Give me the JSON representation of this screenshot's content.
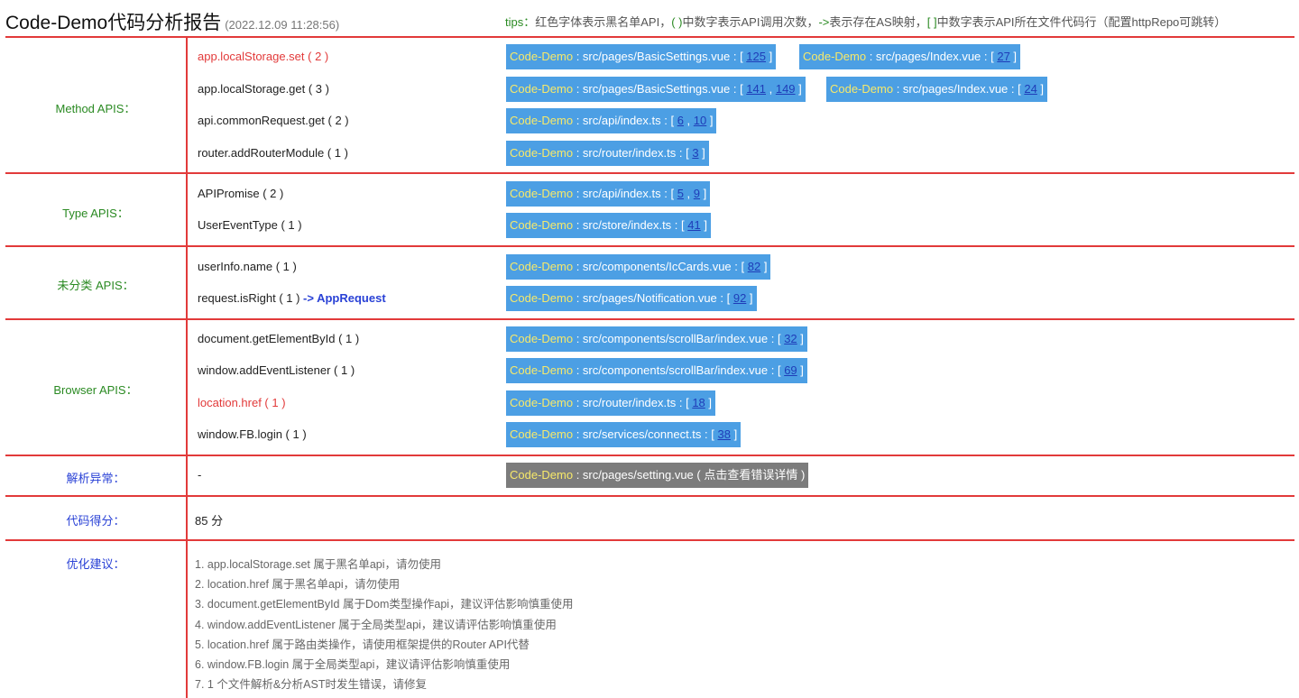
{
  "header": {
    "title": "Code-Demo代码分析报告",
    "time": "(2022.12.09 11:28:56)",
    "tips_prefix": "tips：",
    "tips_text": "红色字体表示黑名单API，",
    "tips_paren": "( )",
    "tips_mid1": "中数字表示API调用次数，",
    "tips_arrow": "->",
    "tips_mid2": "表示存在AS映射，",
    "tips_bracket": "[ ]",
    "tips_end": "中数字表示API所在文件代码行（配置httpRepo可跳转）"
  },
  "sections": {
    "method": {
      "label": "Method APIS：",
      "rows": [
        {
          "api": "app.localStorage.set ( 2 )",
          "chips": [
            {
              "project": "Code-Demo",
              "path": " : src/pages/BasicSettings.vue : [ ",
              "lines": [
                "125"
              ],
              "end": " ]"
            },
            {
              "project": "Code-Demo",
              "path": " : src/pages/Index.vue : [ ",
              "lines": [
                "27"
              ],
              "end": " ]"
            }
          ]
        },
        {
          "api": "app.localStorage.get ( 3 )",
          "chips": [
            {
              "project": "Code-Demo",
              "path": " : src/pages/BasicSettings.vue : [ ",
              "lines": [
                "141",
                "149"
              ],
              "end": " ]"
            },
            {
              "project": "Code-Demo",
              "path": " : src/pages/Index.vue : [ ",
              "lines": [
                "24"
              ],
              "end": " ]"
            }
          ]
        },
        {
          "api": "api.commonRequest.get ( 2 )",
          "chips": [
            {
              "project": "Code-Demo",
              "path": " : src/api/index.ts : [ ",
              "lines": [
                "6",
                "10"
              ],
              "end": " ]"
            }
          ]
        },
        {
          "api": "router.addRouterModule ( 1 )",
          "chips": [
            {
              "project": "Code-Demo",
              "path": " : src/router/index.ts : [ ",
              "lines": [
                "3"
              ],
              "end": " ]"
            }
          ]
        }
      ]
    },
    "type": {
      "label": "Type APIS：",
      "rows": [
        {
          "api": "APIPromise ( 2 )",
          "chips": [
            {
              "project": "Code-Demo",
              "path": " : src/api/index.ts : [ ",
              "lines": [
                "5",
                "9"
              ],
              "end": " ]"
            }
          ]
        },
        {
          "api": "UserEventType ( 1 )",
          "chips": [
            {
              "project": "Code-Demo",
              "path": " : src/store/index.ts : [ ",
              "lines": [
                "41"
              ],
              "end": " ]"
            }
          ]
        }
      ]
    },
    "uncat": {
      "label": "未分类 APIS：",
      "rows": [
        {
          "api": "userInfo.name ( 1 )",
          "chips": [
            {
              "project": "Code-Demo",
              "path": " : src/components/IcCards.vue : [ ",
              "lines": [
                "82"
              ],
              "end": " ]"
            }
          ]
        },
        {
          "api": "request.isRight ( 1 ) ",
          "arrow": "-> AppRequest",
          "chips": [
            {
              "project": "Code-Demo",
              "path": " : src/pages/Notification.vue : [ ",
              "lines": [
                "92"
              ],
              "end": " ]"
            }
          ]
        }
      ]
    },
    "browser": {
      "label": "Browser APIS：",
      "rows": [
        {
          "api": "document.getElementById ( 1 )",
          "chips": [
            {
              "project": "Code-Demo",
              "path": " : src/components/scrollBar/index.vue : [ ",
              "lines": [
                "32"
              ],
              "end": " ]"
            }
          ]
        },
        {
          "api": "window.addEventListener ( 1 )",
          "chips": [
            {
              "project": "Code-Demo",
              "path": " : src/components/scrollBar/index.vue : [ ",
              "lines": [
                "69"
              ],
              "end": " ]"
            }
          ]
        },
        {
          "api": "location.href ( 1 )",
          "chips": [
            {
              "project": "Code-Demo",
              "path": " : src/router/index.ts : [ ",
              "lines": [
                "18"
              ],
              "end": " ]"
            }
          ]
        },
        {
          "api": "window.FB.login ( 1 )",
          "chips": [
            {
              "project": "Code-Demo",
              "path": " : src/services/connect.ts : [ ",
              "lines": [
                "38"
              ],
              "end": " ]"
            }
          ]
        }
      ]
    },
    "parse_error": {
      "label": "解析异常：",
      "value": "-",
      "chip_project": "Code-Demo",
      "chip_text": " : src/pages/setting.vue ( 点击查看错误详情 )"
    },
    "score": {
      "label": "代码得分：",
      "value": "85 分"
    },
    "suggestions": {
      "label": "优化建议：",
      "items": [
        "1. app.localStorage.set 属于黑名单api，请勿使用",
        "2. location.href 属于黑名单api，请勿使用",
        "3. document.getElementById 属于Dom类型操作api，建议评估影响慎重使用",
        "4. window.addEventListener 属于全局类型api，建议请评估影响慎重使用",
        "5. location.href 属于路由类操作，请使用框架提供的Router API代替",
        "6. window.FB.login 属于全局类型api，建议请评估影响慎重使用",
        "7. 1 个文件解析&分析AST时发生错误，请修复"
      ]
    }
  },
  "colors": {
    "accent_red": "#e23a3a",
    "label_green": "#2a8a22",
    "label_blue": "#2a42d6",
    "chip_blue": "#4c9fe4",
    "chip_error": "#7c7c7c",
    "project_yellow": "#f7e96a"
  }
}
